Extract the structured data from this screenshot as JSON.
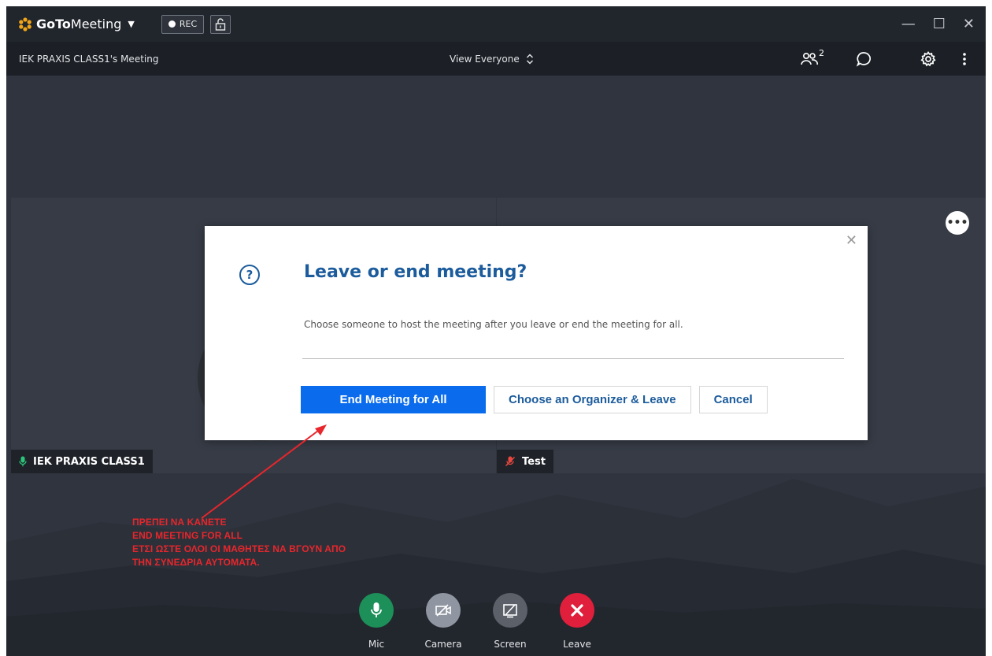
{
  "app": {
    "logo_bold": "GoTo",
    "logo_light": "Meeting",
    "rec_label": "REC"
  },
  "meeting": {
    "title": "IEK PRAXIS CLASS1's Meeting",
    "view_label": "View Everyone",
    "participant_count": "2"
  },
  "tiles": [
    {
      "name": "IEK PRAXIS CLASS1",
      "mic": "on"
    },
    {
      "name": "Test",
      "mic": "muted"
    }
  ],
  "dialog": {
    "title": "Leave or end meeting?",
    "message": "Choose someone to host the meeting after you leave or end the meeting for all.",
    "end_all_label": "End Meeting for All",
    "organizer_label": "Choose an Organizer & Leave",
    "cancel_label": "Cancel"
  },
  "annotation": {
    "lines": [
      "ΠΡΕΠΕΙ ΝΑ ΚΑΝΕΤΕ",
      "END MEETING FOR ALL",
      "ΕΤΣΙ ΩΣΤΕ ΟΛΟΙ ΟΙ ΜΑΘΗΤΕΣ ΝΑ ΒΓΟΥΝ ΑΠΟ",
      "ΤΗΝ ΣΥΝΕΔΡΙΑ ΑΥΤΟΜΑΤΑ."
    ],
    "color": "#e8262c"
  },
  "controls": {
    "mic": "Mic",
    "camera": "Camera",
    "screen": "Screen",
    "leave": "Leave"
  },
  "colors": {
    "brand": "#f2a516",
    "primary": "#0a6ced",
    "dialog_text": "#1c5c9c",
    "mic_green": "#1d8f59",
    "leave_red": "#df1f3b"
  }
}
